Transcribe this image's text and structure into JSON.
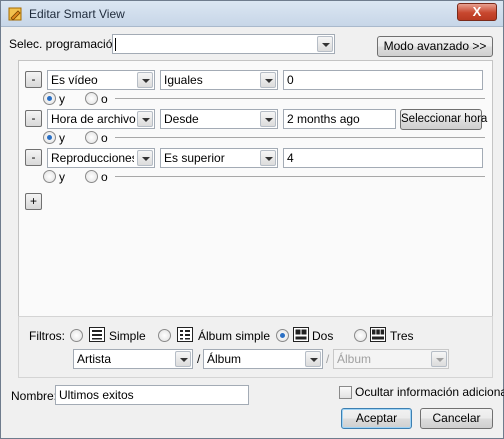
{
  "window": {
    "title": "Editar Smart View",
    "close_label": "X"
  },
  "program": {
    "label": "Selec. programación:",
    "value": "",
    "advanced_label": "Modo avanzado >>"
  },
  "rules": [
    {
      "remove_label": "-",
      "field": "Es vídeo",
      "operator": "Iguales",
      "value": "0",
      "join": "y"
    },
    {
      "remove_label": "-",
      "field": "Hora de archivo",
      "operator": "Desde",
      "value": "2 months ago",
      "select_time_label": "Seleccionar hora",
      "join": "y"
    },
    {
      "remove_label": "-",
      "field": "Reproducciones (l",
      "operator": "Es superior",
      "value": "4",
      "join": "none"
    }
  ],
  "join_labels": {
    "and": "y",
    "or": "o"
  },
  "add_rule_label": "+",
  "filters": {
    "label": "Filtros:",
    "options": [
      {
        "label": "Simple",
        "icon": "list-view-icon",
        "selected": false
      },
      {
        "label": "Álbum simple",
        "icon": "album-simple-view-icon",
        "selected": false
      },
      {
        "label": "Dos",
        "icon": "two-column-view-icon",
        "selected": true
      },
      {
        "label": "Tres",
        "icon": "three-column-view-icon",
        "selected": false
      }
    ],
    "levels": [
      "Artista",
      "Álbum",
      "Álbum"
    ],
    "level_separator": "/"
  },
  "name": {
    "label": "Nombre:",
    "value": "Ultimos exitos"
  },
  "hide_info": {
    "label": "Ocultar información adicional",
    "checked": false
  },
  "actions": {
    "accept": "Aceptar",
    "cancel": "Cancelar"
  },
  "colors": {
    "title_bar": "#c7d6e8",
    "close_button": "#c8472e",
    "radio_selected": "#2a6fc4",
    "default_button_border": "#3c7fb1"
  }
}
